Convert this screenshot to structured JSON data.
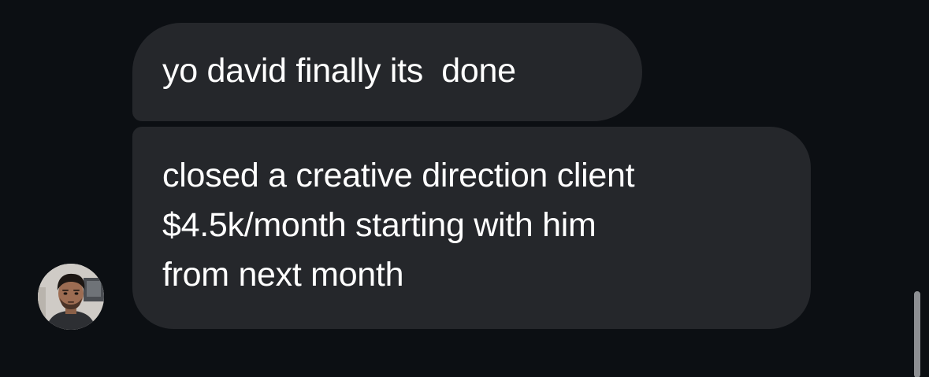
{
  "conversation": {
    "messages": [
      {
        "lines": [
          "yo david finally its  done"
        ]
      },
      {
        "lines": [
          "closed a creative direction client",
          "$4.5k/month starting with him",
          "from next month"
        ]
      }
    ],
    "sender": {
      "avatar_icon": "user-photo-icon"
    }
  },
  "theme": {
    "background": "#0c0f13",
    "bubble": "#25272b",
    "text": "#ffffff",
    "scrollbar": "#8d8f93"
  }
}
